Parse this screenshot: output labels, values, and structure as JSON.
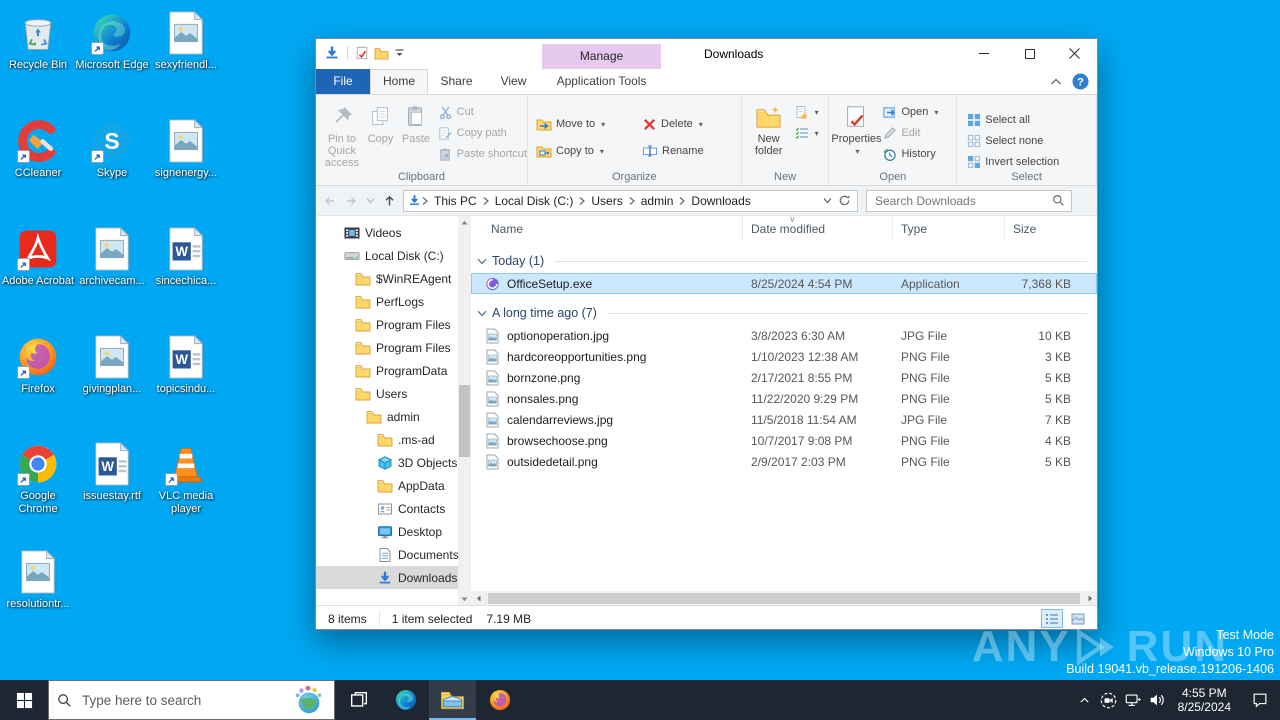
{
  "desktop": {
    "icons": [
      {
        "label": "Recycle Bin",
        "icon": "recycle-bin",
        "shortcut": false
      },
      {
        "label": "Microsoft Edge",
        "icon": "edge",
        "shortcut": true
      },
      {
        "label": "sexyfriendl...",
        "icon": "image-file",
        "shortcut": false
      },
      {
        "label": "CCleaner",
        "icon": "ccleaner",
        "shortcut": true
      },
      {
        "label": "Skype",
        "icon": "skype",
        "shortcut": true
      },
      {
        "label": "signenergy...",
        "icon": "image-file",
        "shortcut": false
      },
      {
        "label": "Adobe Acrobat",
        "icon": "adobe",
        "shortcut": true
      },
      {
        "label": "archivecam...",
        "icon": "image-file",
        "shortcut": false
      },
      {
        "label": "sincechica...",
        "icon": "word-file",
        "shortcut": false
      },
      {
        "label": "Firefox",
        "icon": "firefox",
        "shortcut": true
      },
      {
        "label": "givingplan...",
        "icon": "image-file",
        "shortcut": false
      },
      {
        "label": "topicsindu...",
        "icon": "word-file",
        "shortcut": false
      },
      {
        "label": "Google Chrome",
        "icon": "chrome",
        "shortcut": true
      },
      {
        "label": "issuestay.rtf",
        "icon": "word-file",
        "shortcut": false
      },
      {
        "label": "VLC media player",
        "icon": "vlc",
        "shortcut": true
      },
      {
        "label": "resolutiontr...",
        "icon": "image-file",
        "shortcut": false
      }
    ]
  },
  "explorer": {
    "title": "Downloads",
    "contextual_tab": "Manage",
    "tabs": [
      "File",
      "Home",
      "Share",
      "View",
      "Application Tools"
    ],
    "ribbon": {
      "groups": [
        {
          "label": "Clipboard",
          "layout": "clipboard",
          "big": [
            {
              "label": "Pin to Quick access",
              "icon": "pin",
              "disabled": true
            },
            {
              "label": "Copy",
              "icon": "copy",
              "disabled": true
            },
            {
              "label": "Paste",
              "icon": "paste",
              "disabled": true
            }
          ],
          "small": [
            {
              "label": "Cut",
              "icon": "cut",
              "disabled": true
            },
            {
              "label": "Copy path",
              "icon": "copy-path",
              "disabled": true
            },
            {
              "label": "Paste shortcut",
              "icon": "paste-shortcut",
              "disabled": true
            }
          ]
        },
        {
          "label": "Organize",
          "layout": "grid",
          "small": [
            {
              "label": "Move to",
              "icon": "move-to",
              "caret": true
            },
            {
              "label": "Delete",
              "icon": "delete",
              "caret": true
            },
            {
              "label": "Copy to",
              "icon": "copy-to",
              "caret": true
            },
            {
              "label": "Rename",
              "icon": "rename"
            }
          ]
        },
        {
          "label": "New",
          "layout": "bigsmall",
          "big": [
            {
              "label": "New folder",
              "icon": "new-folder"
            }
          ],
          "small": [
            {
              "label": "",
              "icon": "new-item",
              "caret": true
            },
            {
              "label": "",
              "icon": "easy-access",
              "caret": true
            }
          ]
        },
        {
          "label": "Open",
          "layout": "bigsmall",
          "big": [
            {
              "label": "Properties",
              "icon": "properties",
              "caret": true
            }
          ],
          "small": [
            {
              "label": "Open",
              "icon": "open",
              "caret": true
            },
            {
              "label": "Edit",
              "icon": "edit",
              "disabled": true
            },
            {
              "label": "History",
              "icon": "history"
            }
          ]
        },
        {
          "label": "Select",
          "layout": "smallonly",
          "small": [
            {
              "label": "Select all",
              "icon": "select-all"
            },
            {
              "label": "Select none",
              "icon": "select-none"
            },
            {
              "label": "Invert selection",
              "icon": "invert-selection"
            }
          ]
        }
      ]
    },
    "navbar": {
      "breadcrumbs": [
        "This PC",
        "Local Disk (C:)",
        "Users",
        "admin",
        "Downloads"
      ],
      "search_placeholder": "Search Downloads"
    },
    "tree": [
      {
        "label": "Videos",
        "icon": "videos",
        "level": 0
      },
      {
        "label": "Local Disk (C:)",
        "icon": "disk",
        "level": 0
      },
      {
        "label": "$WinREAgent",
        "icon": "folder",
        "level": 1
      },
      {
        "label": "PerfLogs",
        "icon": "folder",
        "level": 1
      },
      {
        "label": "Program Files",
        "icon": "folder",
        "level": 1
      },
      {
        "label": "Program Files",
        "icon": "folder",
        "level": 1
      },
      {
        "label": "ProgramData",
        "icon": "folder",
        "level": 1
      },
      {
        "label": "Users",
        "icon": "folder",
        "level": 1
      },
      {
        "label": "admin",
        "icon": "folder",
        "level": 2
      },
      {
        "label": ".ms-ad",
        "icon": "folder",
        "level": 3
      },
      {
        "label": "3D Objects",
        "icon": "cube",
        "level": 3
      },
      {
        "label": "AppData",
        "icon": "folder",
        "level": 3
      },
      {
        "label": "Contacts",
        "icon": "contacts",
        "level": 3
      },
      {
        "label": "Desktop",
        "icon": "desktop",
        "level": 3
      },
      {
        "label": "Documents",
        "icon": "documents",
        "level": 3
      },
      {
        "label": "Downloads",
        "icon": "downloads",
        "level": 3,
        "selected": true
      }
    ],
    "columns": [
      "Name",
      "Date modified",
      "Type",
      "Size"
    ],
    "groups": [
      {
        "label": "Today (1)",
        "files": [
          {
            "name": "OfficeSetup.exe",
            "date": "8/25/2024 4:54 PM",
            "type": "Application",
            "size": "7,368 KB",
            "icon": "office",
            "selected": true
          }
        ]
      },
      {
        "label": "A long time ago (7)",
        "files": [
          {
            "name": "optionoperation.jpg",
            "date": "3/8/2023 6:30 AM",
            "type": "JPG File",
            "size": "10 KB",
            "icon": "image"
          },
          {
            "name": "hardcoreopportunities.png",
            "date": "1/10/2023 12:38 AM",
            "type": "PNG File",
            "size": "3 KB",
            "icon": "image"
          },
          {
            "name": "bornzone.png",
            "date": "2/17/2021 8:55 PM",
            "type": "PNG File",
            "size": "5 KB",
            "icon": "image"
          },
          {
            "name": "nonsales.png",
            "date": "11/22/2020 9:29 PM",
            "type": "PNG File",
            "size": "5 KB",
            "icon": "image"
          },
          {
            "name": "calendarreviews.jpg",
            "date": "11/5/2018 11:54 AM",
            "type": "JPG File",
            "size": "7 KB",
            "icon": "image"
          },
          {
            "name": "browsechoose.png",
            "date": "10/7/2017 9:08 PM",
            "type": "PNG File",
            "size": "4 KB",
            "icon": "image"
          },
          {
            "name": "outsidedetail.png",
            "date": "2/9/2017 2:03 PM",
            "type": "PNG File",
            "size": "5 KB",
            "icon": "image"
          }
        ]
      }
    ],
    "status": {
      "items": "8 items",
      "selected": "1 item selected",
      "size": "7.19 MB"
    }
  },
  "taskbar": {
    "search_placeholder": "Type here to search",
    "apps": [
      {
        "name": "task-view",
        "active": false
      },
      {
        "name": "edge",
        "active": false
      },
      {
        "name": "file-explorer",
        "active": true
      },
      {
        "name": "firefox",
        "active": false
      }
    ],
    "time": "4:55 PM",
    "date": "8/25/2024"
  },
  "watermark": {
    "brand_left": "ANY",
    "brand_right": "RUN",
    "lines": [
      "Test Mode",
      "Windows 10 Pro",
      "Build 19041.vb_release.191206-1406"
    ]
  }
}
